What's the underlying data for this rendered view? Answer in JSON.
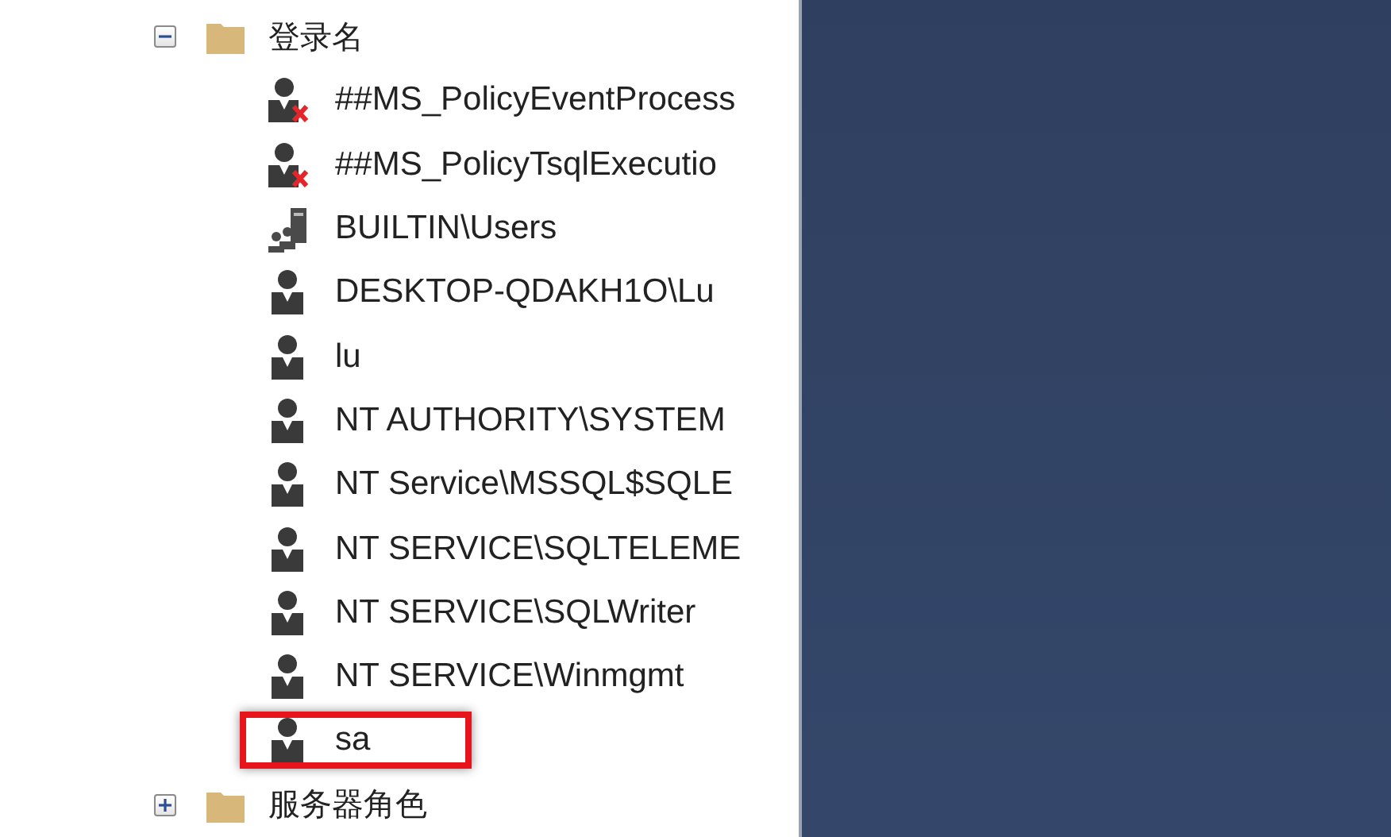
{
  "tree": [
    {
      "label": "登录名",
      "kind": "folder",
      "expanded": true,
      "children": [
        {
          "label": "##MS_PolicyEventProcess",
          "kind": "user_disabled",
          "highlighted": false
        },
        {
          "label": "##MS_PolicyTsqlExecutio",
          "kind": "user_disabled",
          "highlighted": false
        },
        {
          "label": "BUILTIN\\Users",
          "kind": "group",
          "highlighted": false
        },
        {
          "label": "DESKTOP-QDAKH1O\\Lu",
          "kind": "user",
          "highlighted": false
        },
        {
          "label": "lu",
          "kind": "user",
          "highlighted": false
        },
        {
          "label": "NT AUTHORITY\\SYSTEM",
          "kind": "user",
          "highlighted": false
        },
        {
          "label": "NT Service\\MSSQL$SQLE",
          "kind": "user",
          "highlighted": false
        },
        {
          "label": "NT SERVICE\\SQLTELEME",
          "kind": "user",
          "highlighted": false
        },
        {
          "label": "NT SERVICE\\SQLWriter",
          "kind": "user",
          "highlighted": false
        },
        {
          "label": "NT SERVICE\\Winmgmt",
          "kind": "user",
          "highlighted": false
        },
        {
          "label": "sa",
          "kind": "user",
          "highlighted": true
        }
      ]
    },
    {
      "label": "服务器角色",
      "kind": "folder",
      "expanded": false
    }
  ]
}
